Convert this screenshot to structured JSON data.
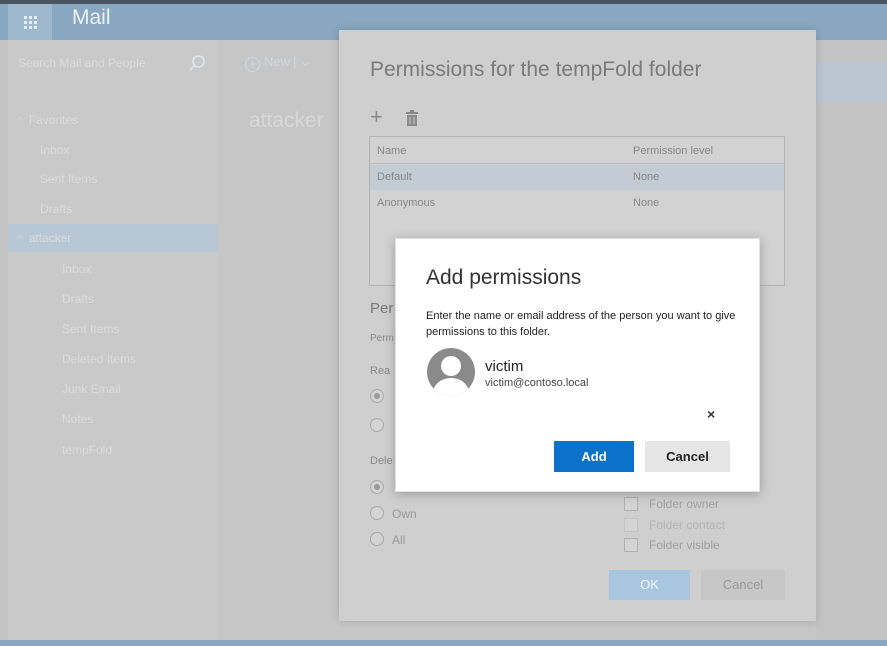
{
  "app": {
    "title": "Mail"
  },
  "search": {
    "placeholder": "Search Mail and People"
  },
  "toolbar": {
    "new_label": "New"
  },
  "nav": {
    "favorites_label": "Favorites",
    "favorites": [
      "Inbox",
      "Sent Items",
      "Drafts"
    ],
    "account_label": "attacker",
    "folders": [
      "Inbox",
      "Drafts",
      "Sent Items",
      "Deleted Items",
      "Junk Email",
      "Notes",
      "tempFold"
    ]
  },
  "main": {
    "folder_heading": "attacker"
  },
  "permissions_panel": {
    "title": "Permissions for the tempFold folder",
    "table": {
      "headers": [
        "Name",
        "Permission level"
      ],
      "rows": [
        {
          "name": "Default",
          "level": "None"
        },
        {
          "name": "Anonymous",
          "level": "None"
        }
      ]
    },
    "partial_labels": {
      "section_heading": "Per",
      "perm_label": "Perm",
      "read_label": "Rea",
      "delete_label": "Dele"
    },
    "delete_options": [
      "Own",
      "All"
    ],
    "other_checkboxes": [
      "Folder owner",
      "Folder contact",
      "Folder visible"
    ],
    "ok_label": "OK",
    "cancel_label": "Cancel"
  },
  "dialog": {
    "title": "Add permissions",
    "description": "Enter the name or email address of the person you want to give permissions to this folder.",
    "person": {
      "name": "victim",
      "email": "victim@contoso.local"
    },
    "remove_glyph": "×",
    "add_label": "Add",
    "cancel_label": "Cancel"
  },
  "colors": {
    "accent": "#0a72c9",
    "header": "#8aa7c1"
  }
}
